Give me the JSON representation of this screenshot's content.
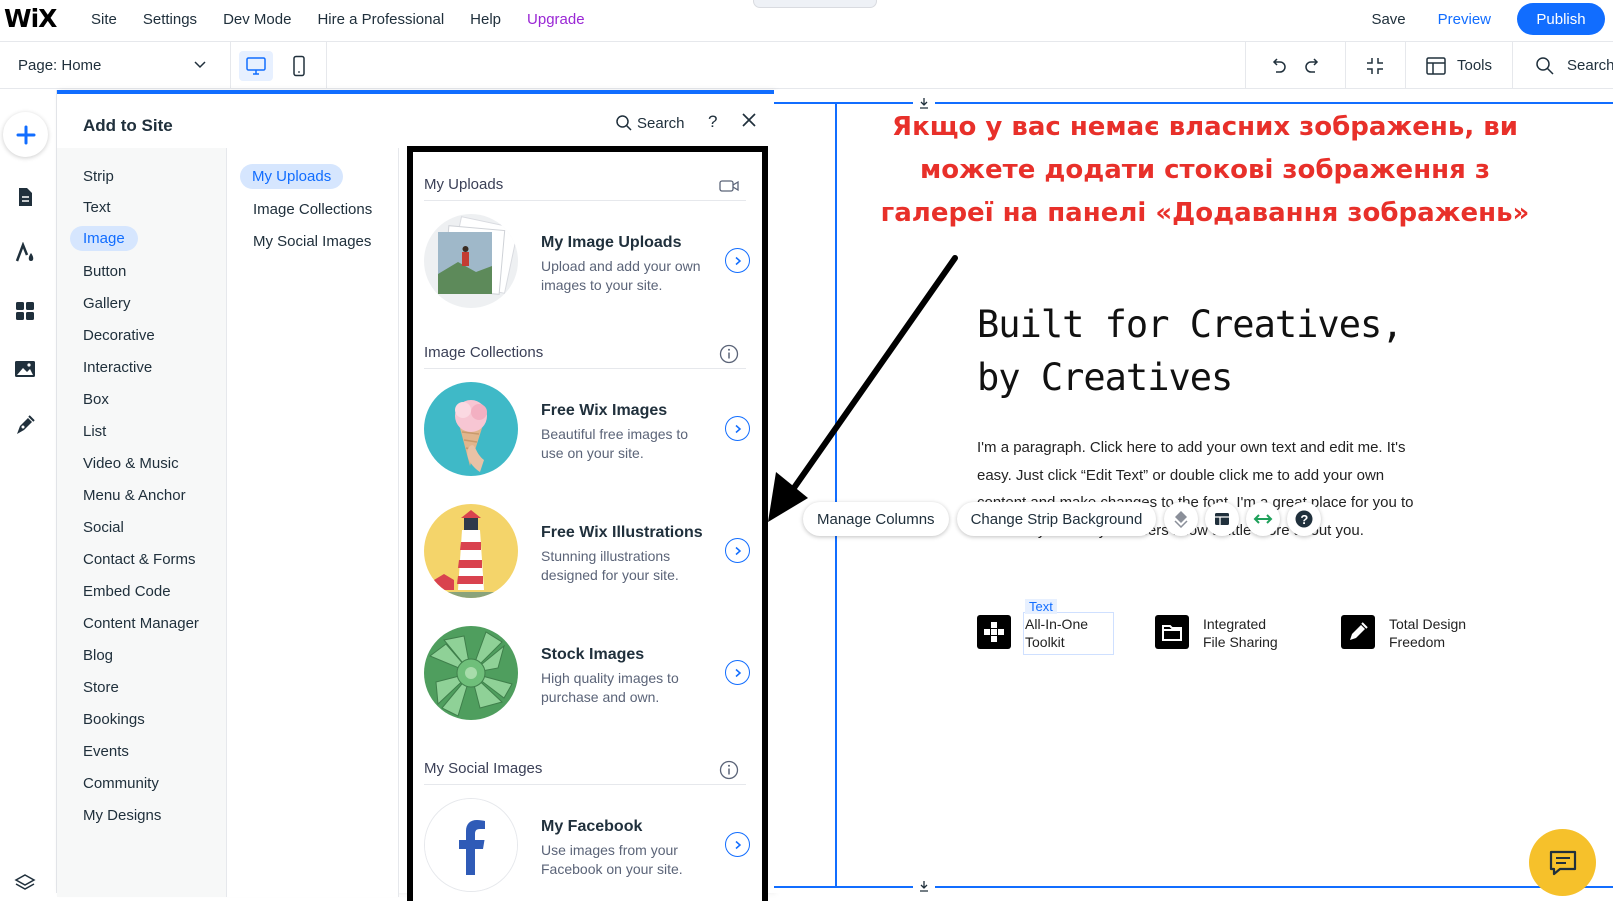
{
  "topbar": {
    "logo": "WiX",
    "menu": [
      "Site",
      "Settings",
      "Dev Mode",
      "Hire a Professional",
      "Help",
      "Upgrade"
    ],
    "save": "Save",
    "preview": "Preview",
    "publish": "Publish"
  },
  "toolbar": {
    "page_label": "Page: Home",
    "tools": "Tools",
    "search": "Search"
  },
  "panel": {
    "title": "Add to Site",
    "search": "Search",
    "help": "?",
    "categories": [
      "Strip",
      "Text",
      "Image",
      "Button",
      "Gallery",
      "Decorative",
      "Interactive",
      "Box",
      "List",
      "Video & Music",
      "Menu & Anchor",
      "Social",
      "Contact & Forms",
      "Embed Code",
      "Content Manager",
      "Blog",
      "Store",
      "Bookings",
      "Events",
      "Community",
      "My Designs"
    ],
    "selected_category": "Image",
    "subcategories": [
      "My Uploads",
      "Image Collections",
      "My Social Images"
    ],
    "selected_subcategory": "My Uploads",
    "sections": {
      "uploads": "My Uploads",
      "collections": "Image Collections",
      "social": "My Social Images"
    },
    "cards": {
      "uploads": {
        "title": "My Image Uploads",
        "desc": "Upload and add your own images to your site."
      },
      "free_images": {
        "title": "Free Wix Images",
        "desc": "Beautiful free images to use on your site."
      },
      "illustrations": {
        "title": "Free Wix Illustrations",
        "desc": "Stunning illustrations designed for your site."
      },
      "stock": {
        "title": "Stock Images",
        "desc": "High quality images to purchase and own."
      },
      "facebook": {
        "title": "My Facebook",
        "desc": "Use images from your Facebook on your site."
      }
    }
  },
  "canvas": {
    "annotation": "Якщо у вас немає власних зображень, ви можете додати стокові зображення з галереї на панелі «Додавання зображень»",
    "headline_1": "Built for Creatives,",
    "headline_2": "by Creatives",
    "paragraph": "I'm a paragraph. Click here to add your own text and edit me. It's easy. Just click “Edit Text” or double click me to add your own content and make changes to the font. I'm a great place for you to tell a story and let your users know a little more about you.",
    "floatbar": {
      "manage_columns": "Manage Columns",
      "change_bg": "Change Strip Background",
      "help": "?"
    },
    "text_tag": "Text",
    "features": [
      {
        "line1": "All-In-One",
        "line2": "Toolkit"
      },
      {
        "line1": "Integrated",
        "line2": "File Sharing"
      },
      {
        "line1": "Total Design",
        "line2": "Freedom"
      }
    ]
  },
  "colors": {
    "accent": "#116dff",
    "upgrade": "#9a27d5",
    "annotation": "#e8302a",
    "chat": "#f6c12b"
  }
}
